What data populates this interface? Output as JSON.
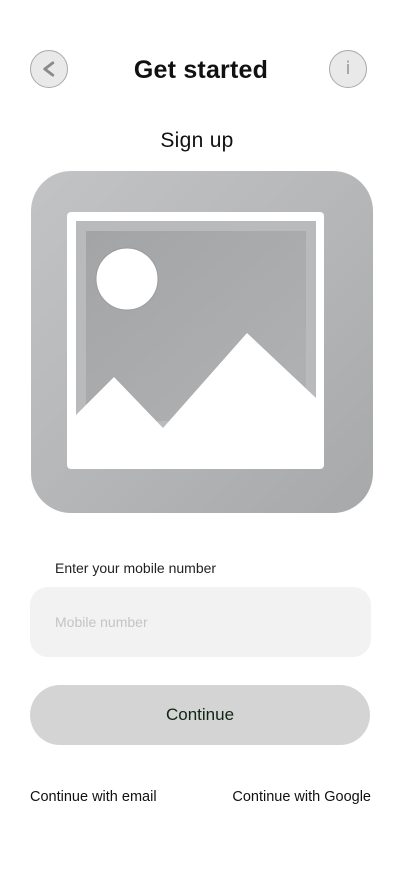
{
  "header": {
    "title": "Get started",
    "back_icon": "chevron-left-icon",
    "info_icon": "info-icon",
    "info_glyph": "i"
  },
  "subtitle": "Sign up",
  "hero_image": {
    "icon": "image-placeholder-icon"
  },
  "form": {
    "mobile_label": "Enter your mobile number",
    "mobile_placeholder": "Mobile number",
    "mobile_value": "",
    "continue_label": "Continue"
  },
  "alternatives": {
    "email_label": "Continue with email",
    "google_label": "Continue with Google"
  },
  "colors": {
    "button_bg": "#d4d4d4",
    "input_bg": "#f2f2f2",
    "button_text": "#0f2614"
  }
}
